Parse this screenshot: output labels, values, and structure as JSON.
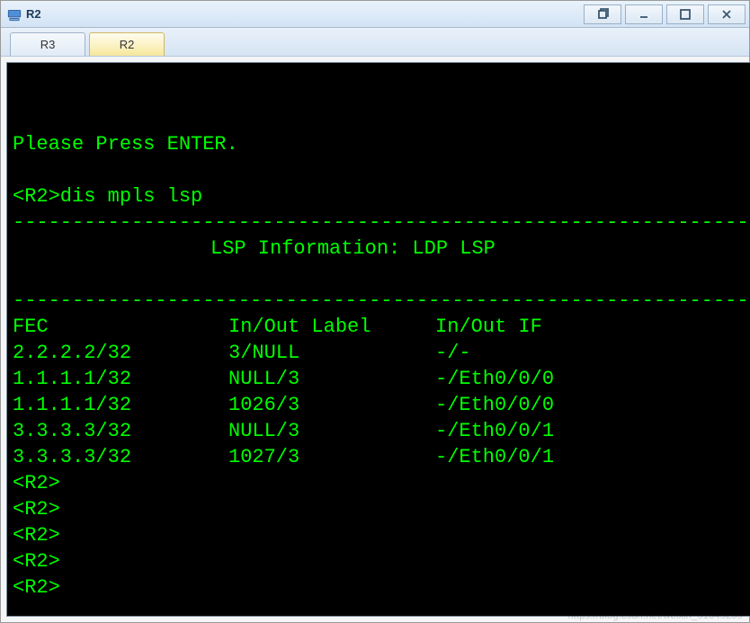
{
  "window": {
    "title": "R2"
  },
  "tabs": [
    {
      "label": "R3",
      "active": false
    },
    {
      "label": "R2",
      "active": true
    }
  ],
  "terminal": {
    "intro": "Please Press ENTER.",
    "prompt_command": "<R2>dis mpls lsp",
    "divider": "-------------------------------------------------------------------------------",
    "section_title": "LSP Information: LDP LSP",
    "table_header": {
      "fec": "FEC",
      "io_label": "In/Out Label",
      "io_if": "In/Out IF"
    },
    "rows": [
      {
        "fec": "2.2.2.2/32",
        "io_label": "3/NULL",
        "io_if": "-/-"
      },
      {
        "fec": "1.1.1.1/32",
        "io_label": "NULL/3",
        "io_if": "-/Eth0/0/0"
      },
      {
        "fec": "1.1.1.1/32",
        "io_label": "1026/3",
        "io_if": "-/Eth0/0/0"
      },
      {
        "fec": "3.3.3.3/32",
        "io_label": "NULL/3",
        "io_if": "-/Eth0/0/1"
      },
      {
        "fec": "3.3.3.3/32",
        "io_label": "1027/3",
        "io_if": "-/Eth0/0/1"
      }
    ],
    "trailing_prompts": [
      "<R2>",
      "<R2>",
      "<R2>",
      "<R2>",
      "<R2>"
    ]
  },
  "watermark": "https://blog.csdn.net/weixin_51045259"
}
